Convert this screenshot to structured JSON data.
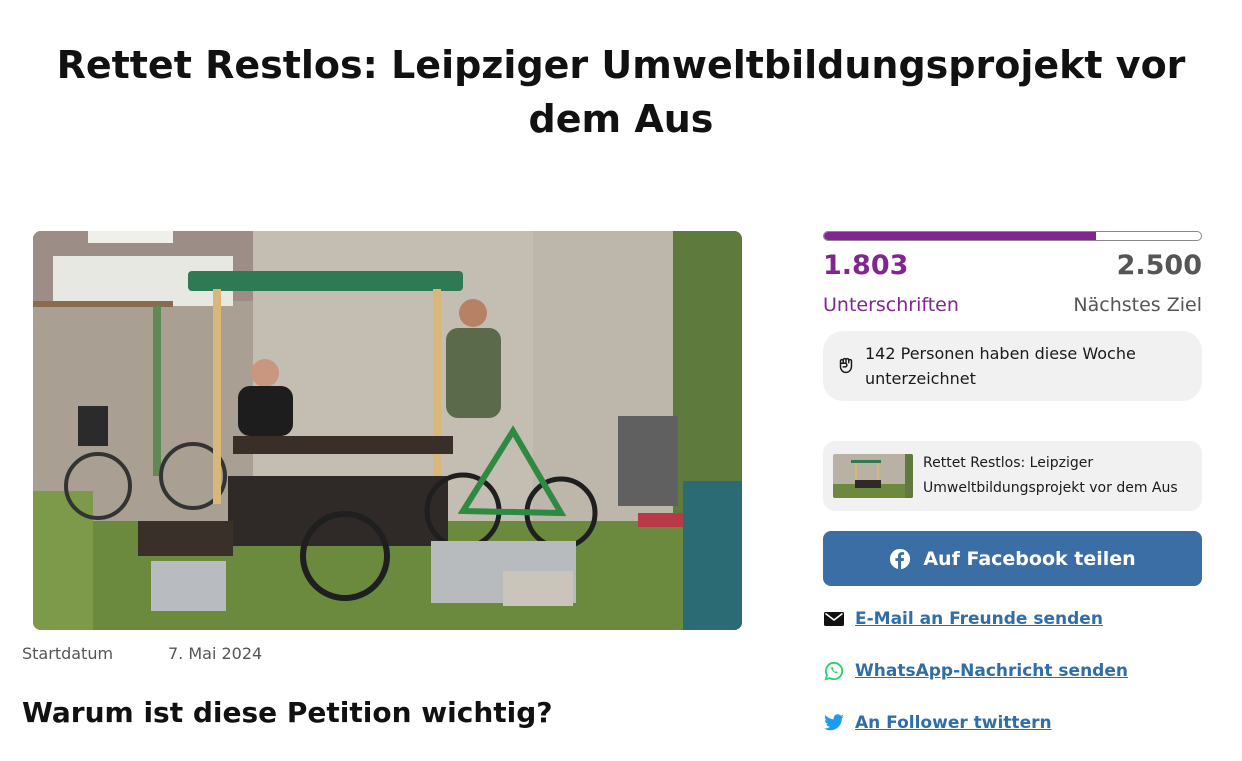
{
  "petition": {
    "title": "Rettet Restlos: Leipziger Umweltbildungsprojekt vor dem Aus",
    "start_label": "Startdatum",
    "start_date": "7. Mai 2024",
    "section_heading": "Warum ist diese Petition wichtig?"
  },
  "signatures": {
    "count": "1.803",
    "count_label": "Unterschriften",
    "goal": "2.500",
    "goal_label": "Nächstes Ziel",
    "progress_fraction": 0.721,
    "weekly_text": "142 Personen haben diese Woche unterzeichnet",
    "weekly_icon": "raised-fist-icon"
  },
  "share": {
    "card_title": "Rettet Restlos: Leipziger Umweltbildungsprojekt vor dem Aus",
    "facebook_label": "Auf Facebook teilen",
    "email_label": "E-Mail an Freunde senden",
    "whatsapp_label": "WhatsApp-Nachricht senden",
    "twitter_label": "An Follower twittern"
  },
  "colors": {
    "accent_purple": "#80278f",
    "facebook_blue": "#3a6ea5",
    "link_blue": "#2f6ea8",
    "whatsapp_green": "#25d366",
    "twitter_blue": "#1d9bf0"
  }
}
